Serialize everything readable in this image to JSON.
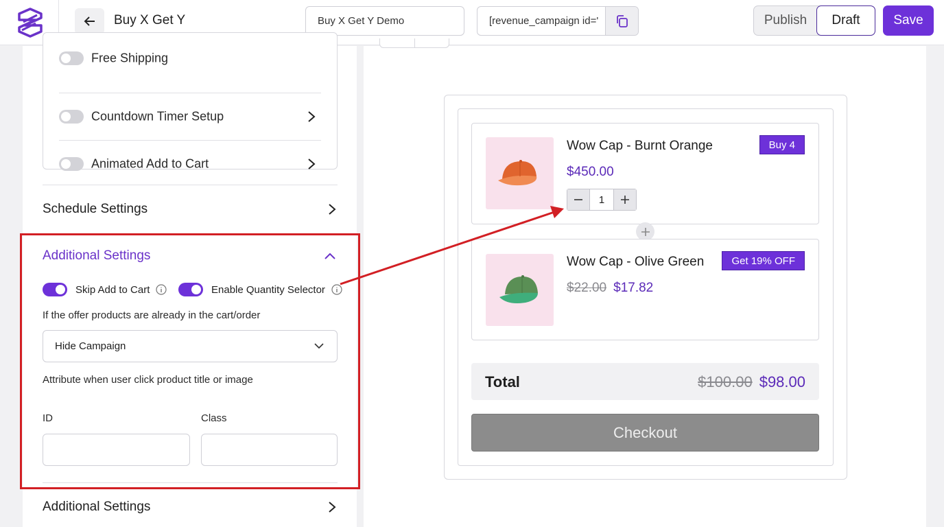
{
  "header": {
    "page_title": "Buy X Get Y",
    "campaign_name": "Buy X Get Y Demo",
    "shortcode": "[revenue_campaign id='",
    "publish_label": "Publish",
    "draft_label": "Draft",
    "save_label": "Save"
  },
  "extras": [
    {
      "label": "Free Shipping",
      "enabled": false,
      "has_chevron": false
    },
    {
      "label": "Countdown Timer Setup",
      "enabled": false,
      "has_chevron": true
    },
    {
      "label": "Animated Add to Cart",
      "enabled": false,
      "has_chevron": true
    }
  ],
  "schedule_settings": {
    "title": "Schedule Settings"
  },
  "additional_settings": {
    "title": "Additional Settings",
    "skip_add_to_cart": {
      "label": "Skip Add to Cart",
      "enabled": true
    },
    "enable_quantity_selector": {
      "label": "Enable Quantity Selector",
      "enabled": true
    },
    "in_cart_label": "If the offer products are already in the cart/order",
    "in_cart_value": "Hide Campaign",
    "attribute_label": "Attribute when user click product title or image",
    "id_label": "ID",
    "id_value": "",
    "class_label": "Class",
    "class_value": ""
  },
  "additional_settings_2": {
    "title": "Additional Settings"
  },
  "preview": {
    "products": [
      {
        "name": "Wow Cap - Burnt Orange",
        "price": "$450.00",
        "badge": "Buy 4",
        "quantity": "1",
        "color": "#e0642e"
      },
      {
        "name": "Wow Cap - Olive Green",
        "old_price": "$22.00",
        "price": "$17.82",
        "badge": "Get 19% OFF",
        "color": "#5a8f55"
      }
    ],
    "total_label": "Total",
    "total_old": "$100.00",
    "total_new": "$98.00",
    "checkout_label": "Checkout"
  },
  "colors": {
    "accent": "#6d31d9",
    "price": "#5b2ab8",
    "highlight": "#d21f24"
  }
}
